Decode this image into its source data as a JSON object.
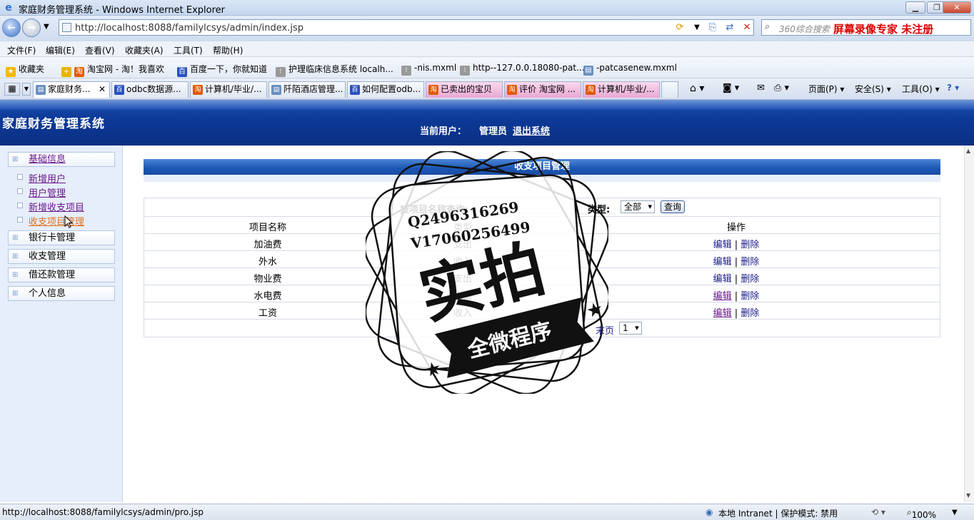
{
  "window": {
    "title": "家庭财务管理系统 - Windows Internet Explorer"
  },
  "address": {
    "url": "http://localhost:8088/familylcsys/admin/index.jsp"
  },
  "search": {
    "placeholder": "360综合搜索",
    "recorder": "屏幕录像专家  未注册"
  },
  "menu": [
    "文件(F)",
    "编辑(E)",
    "查看(V)",
    "收藏夹(A)",
    "工具(T)",
    "帮助(H)"
  ],
  "favorites": {
    "label": "收藏夹",
    "items": [
      "淘宝网 - 淘！我喜欢",
      "百度一下，你就知道",
      "护理临床信息系统 localh...",
      "-nis.mxml",
      "http--127.0.0.18080-pat...",
      "-patcasenew.mxml"
    ]
  },
  "tabs": [
    "家庭财务...",
    "odbc数据源...",
    "计算机/毕业/...",
    "阡陌酒店管理...",
    "如何配置odb...",
    "已卖出的宝贝",
    "评价 淘宝网 ...",
    "计算机/毕业/..."
  ],
  "commands": {
    "page": "页面(P)",
    "safety": "安全(S)",
    "tools": "工具(O)"
  },
  "header": {
    "system_name": "家庭财务管理系统",
    "current_user_label": "当前用户：",
    "user_name": "管理员",
    "logout": "退出系统"
  },
  "sidebar": {
    "groups": [
      "基础信息",
      "银行卡管理",
      "收支管理",
      "借还款管理",
      "个人信息"
    ],
    "items": [
      "新增用户",
      "用户管理",
      "新增收支项目",
      "收支项目管理"
    ]
  },
  "panel": {
    "title": "收支项目管理",
    "search_label": "按项目名称查询:",
    "type_label": "类型:",
    "type_value": "全部",
    "query_button": "查询"
  },
  "table": {
    "headers": [
      "项目名称",
      "类型",
      "操作"
    ],
    "rows": [
      {
        "name": "加油费",
        "type": "支出"
      },
      {
        "name": "外水",
        "type": "收入"
      },
      {
        "name": "物业费",
        "type": "支出"
      },
      {
        "name": "水电费",
        "type": "支出"
      },
      {
        "name": "工资",
        "type": "收入"
      }
    ],
    "edit": "编辑",
    "sep": "|",
    "delete": "删除"
  },
  "pager": {
    "next": "下页",
    "last": "末页",
    "page": "1"
  },
  "watermark": {
    "qq": "Q2496316269",
    "v": "V17060256499",
    "big": "实拍",
    "ribbon": "全微程序"
  },
  "status": {
    "url": "http://localhost:8088/familylcsys/admin/pro.jsp",
    "zone": "本地 Intranet | 保护模式: 禁用",
    "zoom": "100%"
  }
}
